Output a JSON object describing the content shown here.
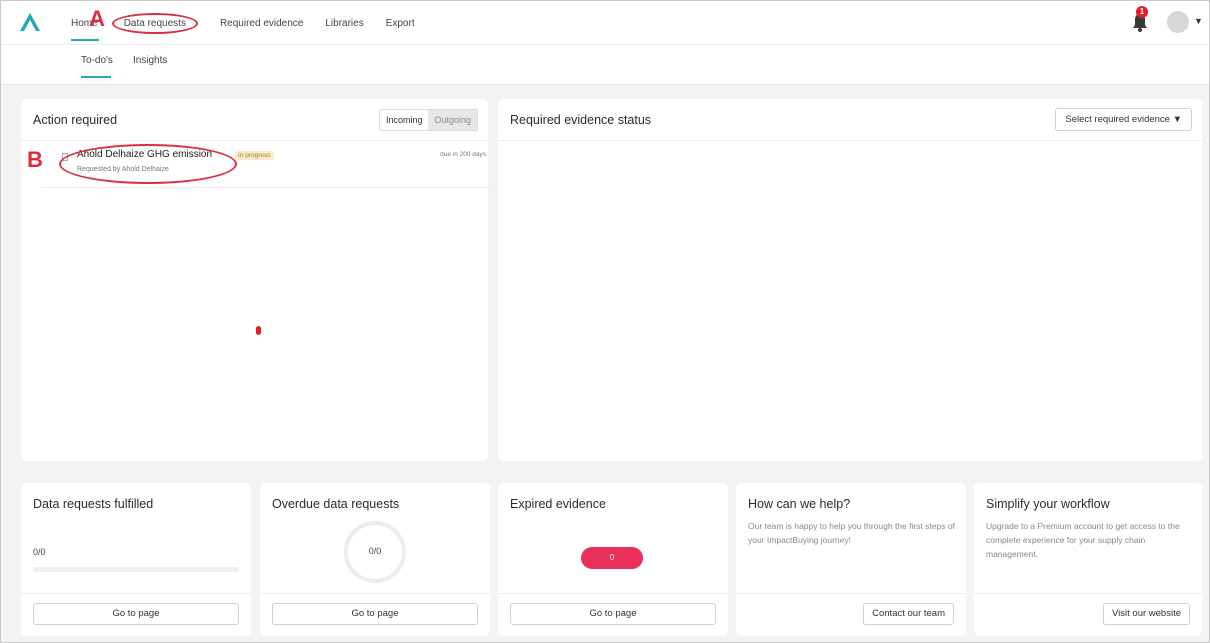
{
  "nav": {
    "items": [
      "Home",
      "Data requests",
      "Required evidence",
      "Libraries",
      "Export"
    ],
    "notification_count": "1"
  },
  "subnav": {
    "items": [
      "To-do's",
      "Insights"
    ]
  },
  "annotations": {
    "a": "A",
    "b": "B"
  },
  "action_required": {
    "title": "Action required",
    "toggle": [
      "Incoming",
      "Outgoing"
    ],
    "request": {
      "name": "Ahold Delhaize GHG emission",
      "status": "In progress",
      "requested_by": "Requested by Ahold Delhaize",
      "due": "due in 200 days"
    }
  },
  "evidence_status": {
    "title": "Required evidence status",
    "select_label": "Select required evidence ▼"
  },
  "bottom": {
    "fulfilled": {
      "title": "Data requests fulfilled",
      "value": "0/0",
      "progress": 0,
      "button": "Go to page"
    },
    "overdue": {
      "title": "Overdue data requests",
      "value": "0/0",
      "button": "Go to page"
    },
    "expired": {
      "title": "Expired evidence",
      "value": "0",
      "button": "Go to page"
    },
    "help": {
      "title": "How can we help?",
      "text": "Our team is happy to help you through the first steps of your ImpactBuying journey!",
      "button": "Contact our team"
    },
    "workflow": {
      "title": "Simplify your workflow",
      "text": "Upgrade to a Premium account to get access to the complete experience for your supply chain management.",
      "button": "Visit our website"
    }
  },
  "colors": {
    "accent": "#2aa7b6",
    "alert": "#e11c2b",
    "pill": "#e8305a",
    "annotation": "#d93040"
  }
}
